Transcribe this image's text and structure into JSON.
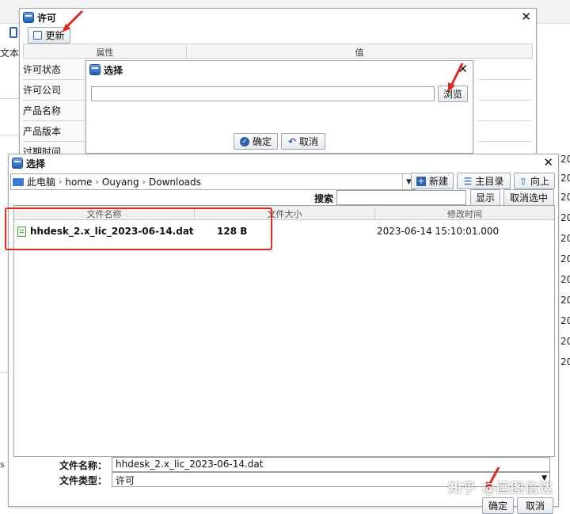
{
  "background": {
    "left_label": "文本",
    "right_column_years": [
      "20",
      "20",
      "20",
      "20",
      "20",
      "20",
      "20",
      "20",
      "20",
      "20",
      "20",
      "20",
      "20"
    ],
    "bottom_left_text": "s"
  },
  "license_window": {
    "title": "许可",
    "update_button": "更新",
    "columns": {
      "property": "属性",
      "value": "值"
    },
    "rows": [
      "许可状态",
      "许可公司",
      "产品名称",
      "产品版本",
      "过期时间"
    ]
  },
  "select_small_dialog": {
    "title": "选择",
    "path_value": "",
    "browse_button": "浏览",
    "ok_button": "确定",
    "cancel_button": "取消"
  },
  "file_chooser": {
    "title": "选择",
    "breadcrumb": [
      "此电脑",
      "home",
      "Ouyang",
      "Downloads"
    ],
    "new_button": "新建",
    "home_button": "主目录",
    "up_button": "向上",
    "search_label": "搜索",
    "search_value": "",
    "show_button": "显示",
    "cancel_selection_button": "取消选中",
    "columns": {
      "name": "文件名称",
      "size": "文件大小",
      "modified": "修改时间"
    },
    "files": [
      {
        "name": "hhdesk_2.x_lic_2023-06-14.dat",
        "size": "128 B",
        "modified": "2023-06-14 15:10:01.000"
      }
    ],
    "filename_label": "文件名称：",
    "filename_value": "hhdesk_2.x_lic_2023-06-14.dat",
    "filetype_label": "文件类型：",
    "filetype_value": "许可",
    "ok_button": "确定",
    "cancel_button": "取消"
  },
  "watermark": "知乎 @画图信达",
  "colors": {
    "annotation_red": "#e0281f",
    "title_icon_blue": "#1f5fb5"
  }
}
